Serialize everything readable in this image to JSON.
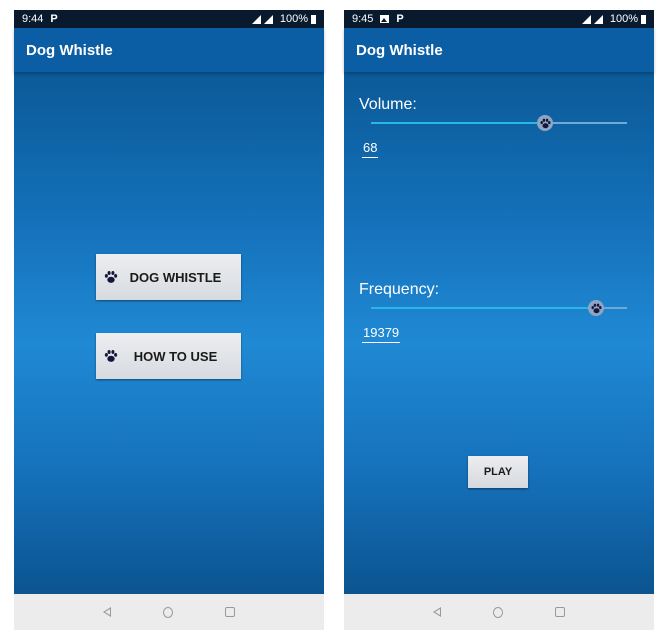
{
  "screens": [
    {
      "status_bar": {
        "time": "9:44",
        "notification_icons": [
          "parking-icon"
        ],
        "battery": "100%"
      },
      "app_title": "Dog Whistle",
      "buttons": [
        {
          "label": "DOG WHISTLE",
          "icon": "paw-icon"
        },
        {
          "label": "HOW TO USE",
          "icon": "paw-icon"
        }
      ]
    },
    {
      "status_bar": {
        "time": "9:45",
        "notification_icons": [
          "image-icon",
          "parking-icon"
        ],
        "battery": "100%"
      },
      "app_title": "Dog Whistle",
      "volume": {
        "label": "Volume:",
        "value": "68",
        "slider_fraction": 0.68
      },
      "frequency": {
        "label": "Frequency:",
        "value": "19379",
        "slider_fraction": 0.88
      },
      "play_label": "PLAY"
    }
  ],
  "nav_bar": [
    "back-icon",
    "home-icon",
    "recents-icon"
  ],
  "colors": {
    "app_bar": "#0b5ea3",
    "status_bar": "#0a1a2e",
    "slider_fill": "#29b6e8",
    "nav_bar": "#ececec"
  }
}
